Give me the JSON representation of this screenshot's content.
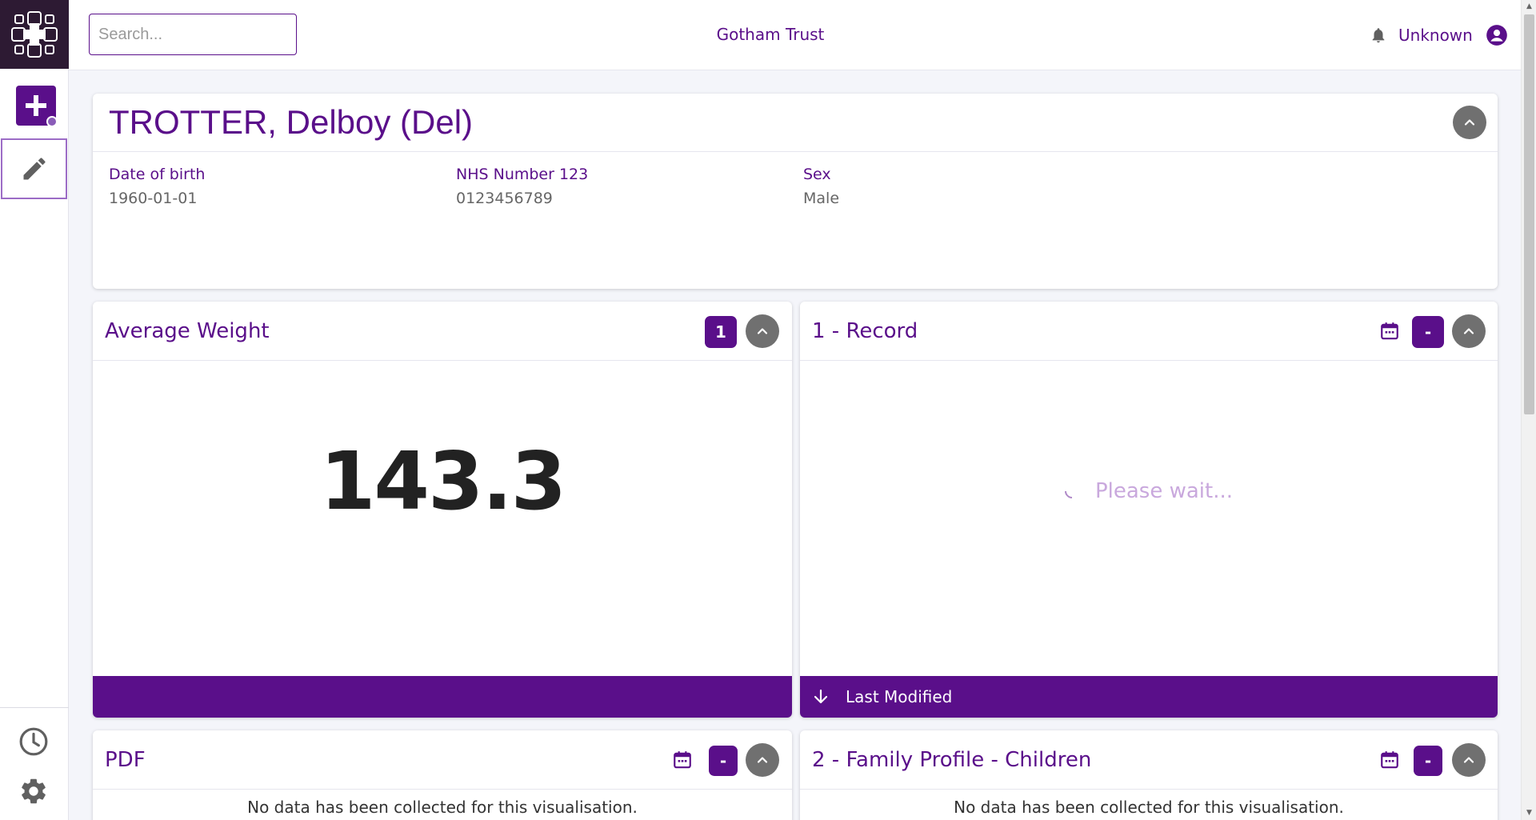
{
  "search": {
    "placeholder": "Search..."
  },
  "header": {
    "org_name": "Gotham Trust",
    "user_name": "Unknown"
  },
  "patient": {
    "name": "TROTTER, Delboy (Del)",
    "fields": [
      {
        "label": "Date of birth",
        "value": "1960-01-01"
      },
      {
        "label": "NHS Number 123",
        "value": "0123456789"
      },
      {
        "label": "Sex",
        "value": "Male"
      }
    ]
  },
  "cards": {
    "average_weight": {
      "title": "Average Weight",
      "count": "1",
      "value": "143.3"
    },
    "record": {
      "title": "1 - Record",
      "count": "-",
      "loading_text": "Please wait...",
      "footer_label": "Last Modified"
    },
    "pdf": {
      "title": "PDF",
      "count": "-",
      "empty_text": "No data has been collected for this visualisation."
    },
    "family_profile": {
      "title": "2 - Family Profile - Children",
      "count": "-",
      "empty_text": "No data has been collected for this visualisation."
    }
  },
  "colors": {
    "brand": "#5a0f8a",
    "logo_bg": "#2d1a33",
    "collapse_btn": "#707070"
  },
  "icons": [
    "logo-icon",
    "add-icon",
    "edit-icon",
    "history-icon",
    "settings-icon",
    "bell-icon",
    "user-avatar-icon",
    "chevron-up-icon",
    "calendar-icon",
    "arrow-down-icon"
  ]
}
